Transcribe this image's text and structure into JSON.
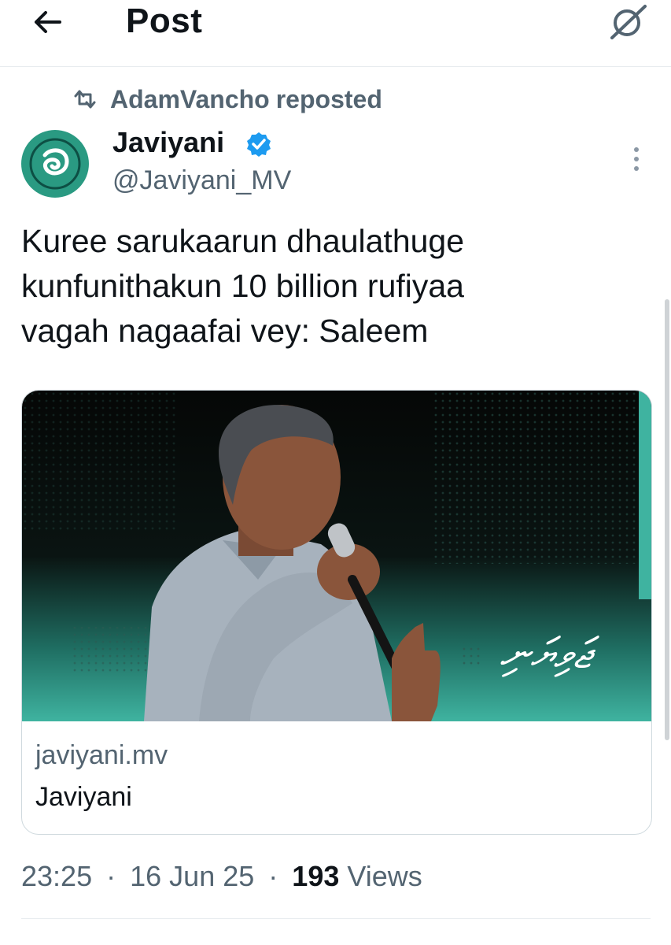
{
  "header": {
    "title": "Post",
    "back_icon": "arrow-left-icon",
    "grok_icon": "grok-icon"
  },
  "repost": {
    "icon": "repost-icon",
    "user": "AdamVancho",
    "suffix": "reposted"
  },
  "author": {
    "name": "Javiyani",
    "handle": "@Javiyani_MV",
    "verified": true,
    "avatar_color": "#2a9a82"
  },
  "tweet": {
    "text": "Kuree sarukaarun dhaulathuge\nkunfunithakun 10 billion rufiyaa\nvagah nagaafai vey: Saleem"
  },
  "card": {
    "domain": "javiyani.mv",
    "title": "Javiyani",
    "image_logo_text": "ޖަވިޔަނި"
  },
  "meta": {
    "time": "23:25",
    "sep": "·",
    "date": "16 Jun 25",
    "views_count": "193",
    "views_label": "Views"
  },
  "colors": {
    "text": "#0f1419",
    "secondary": "#536471",
    "verified": "#1d9bf0",
    "brand": "#2a9a82"
  }
}
